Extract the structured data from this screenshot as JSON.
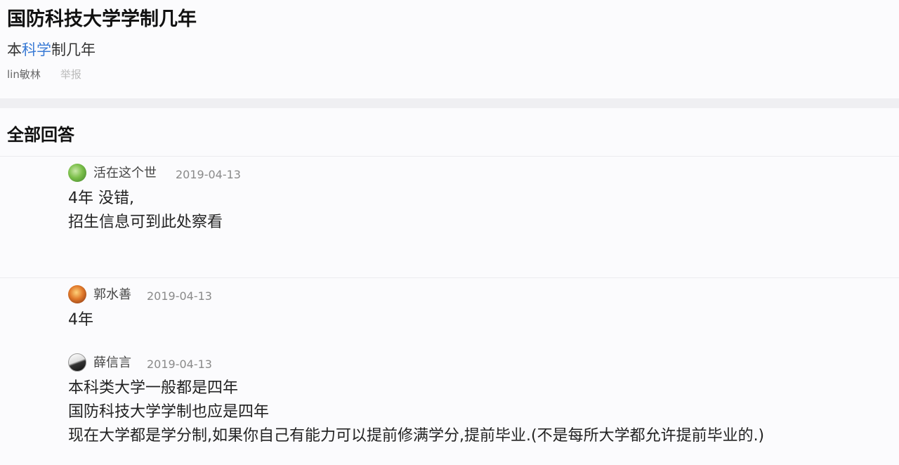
{
  "question": {
    "title": "国防科技大学学制几年",
    "desc_prefix": "本",
    "desc_link": "科学",
    "desc_suffix": "制几年",
    "author": "lin敏林",
    "report": "举报"
  },
  "answers_header": "全部回答",
  "answers": [
    {
      "username": "活在这个世",
      "date": "2019-04-13",
      "avatar": "green-leaf-avatar",
      "lines": [
        "4年 没错,",
        "招生信息可到此处察看"
      ]
    },
    {
      "username": "郭水善",
      "date": "2019-04-13",
      "avatar": "orange-avatar",
      "lines": [
        "4年"
      ]
    },
    {
      "username": "薛信言",
      "date": "2019-04-13",
      "avatar": "black-white-avatar",
      "lines": [
        "本科类大学一般都是四年",
        "国防科技大学学制也应是四年",
        "现在大学都是学分制,如果你自己有能力可以提前修满学分,提前毕业.(不是每所大学都允许提前毕业的.)"
      ]
    }
  ]
}
